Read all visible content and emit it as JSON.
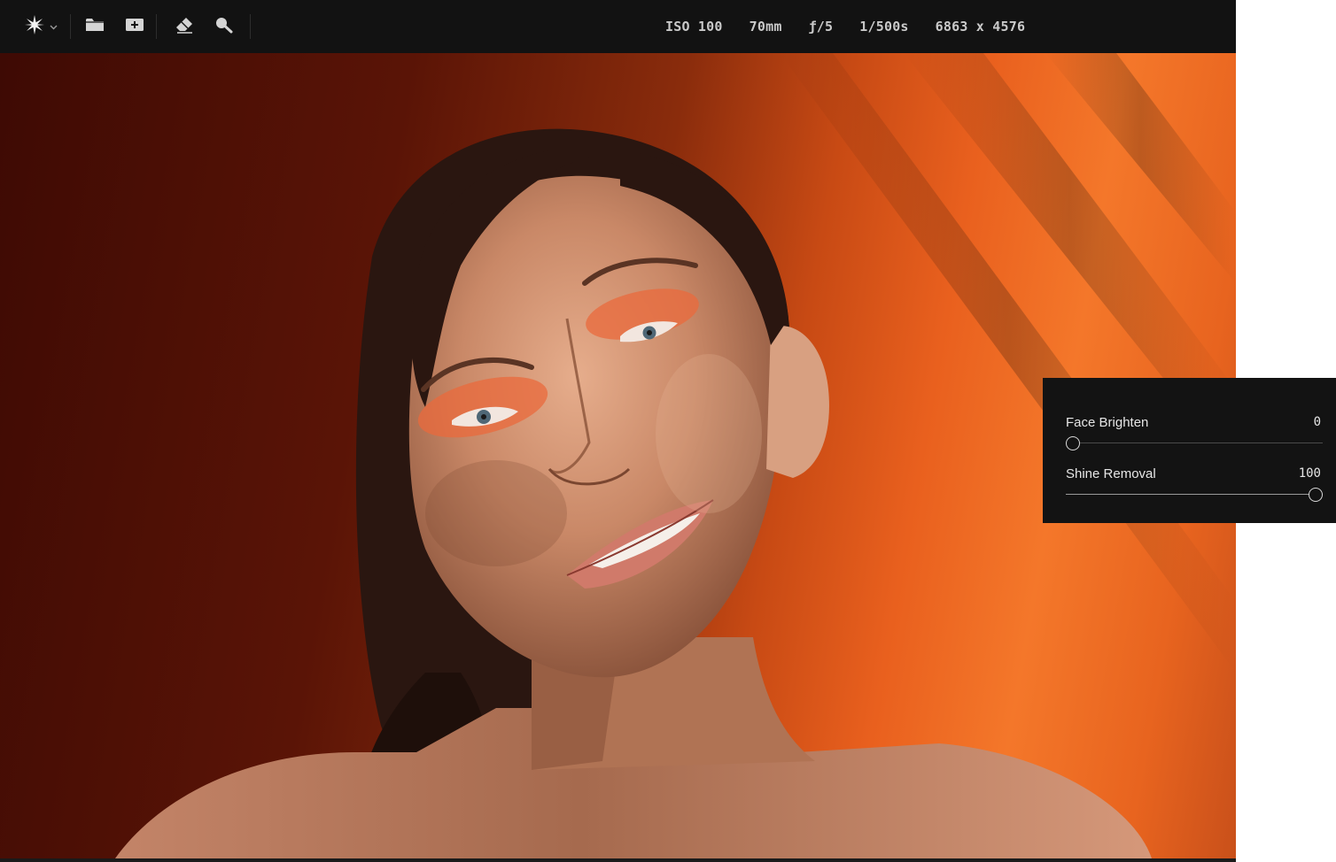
{
  "toolbar": {
    "icons": {
      "brand": "sparkle-icon",
      "brand_menu": "chevron-down-icon",
      "open": "folder-icon",
      "add": "add-photo-icon",
      "erase": "eraser-icon",
      "search": "search-icon"
    }
  },
  "meta": {
    "iso": "ISO 100",
    "focal": "70mm",
    "aperture": "ƒ/5",
    "shutter": "1/500s",
    "dimensions": "6863 x 4576"
  },
  "panel": {
    "face_brighten": {
      "label": "Face Brighten",
      "value": "0",
      "fraction": 0.0
    },
    "shine_removal": {
      "label": "Shine Removal",
      "value": "100",
      "fraction": 1.0
    }
  },
  "colors": {
    "toolbar_bg": "#121212",
    "panel_bg": "#131313",
    "backdrop_orange": "#f4772a",
    "backdrop_deep": "#5a1406"
  }
}
